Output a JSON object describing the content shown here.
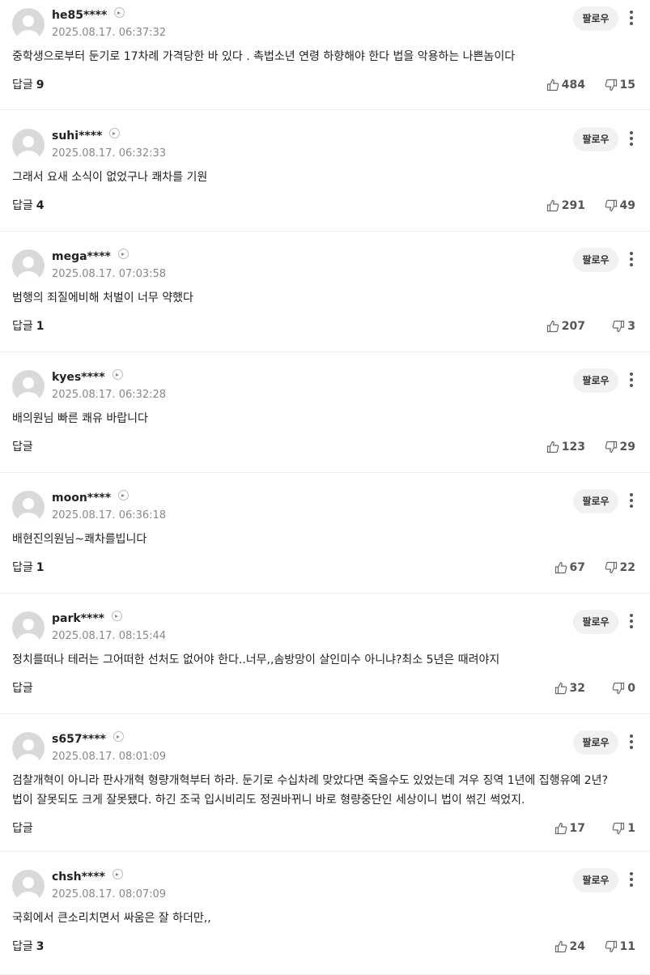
{
  "labels": {
    "follow": "팔로우",
    "reply": "답글"
  },
  "comments": [
    {
      "nickname": "he85****",
      "timestamp": "2025.08.17. 06:37:32",
      "text": "중학생으로부터 둔기로 17차례 가격당한 바 있다 . 촉법소년 연령 하향해야 한다 법을 악용하는 나쁜놈이다",
      "reply_count": "9",
      "likes": "484",
      "dislikes": "15"
    },
    {
      "nickname": "suhi****",
      "timestamp": "2025.08.17. 06:32:33",
      "text": "그래서 요새 소식이 없었구나 쾌차를 기원",
      "reply_count": "4",
      "likes": "291",
      "dislikes": "49"
    },
    {
      "nickname": "mega****",
      "timestamp": "2025.08.17. 07:03:58",
      "text": "범행의 죄질에비해 처벌이 너무 약했다",
      "reply_count": "1",
      "likes": "207",
      "dislikes": "3"
    },
    {
      "nickname": "kyes****",
      "timestamp": "2025.08.17. 06:32:28",
      "text": "배의원님 빠른 쾌유 바랍니다",
      "reply_count": "",
      "likes": "123",
      "dislikes": "29"
    },
    {
      "nickname": "moon****",
      "timestamp": "2025.08.17. 06:36:18",
      "text": "배현진의원님~쾌차를빕니다",
      "reply_count": "1",
      "likes": "67",
      "dislikes": "22"
    },
    {
      "nickname": "park****",
      "timestamp": "2025.08.17. 08:15:44",
      "text": "정치를떠나 테러는 그어떠한 선처도 없어야 한다..너무,,솜방망이 살인미수 아니냐?최소 5년은 때려야지",
      "reply_count": "",
      "likes": "32",
      "dislikes": "0"
    },
    {
      "nickname": "s657****",
      "timestamp": "2025.08.17. 08:01:09",
      "text": "검찰개혁이 아니라 판사개혁 형량개혁부터 하라. 둔기로 수십차례 맞았다면 죽을수도 있었는데 겨우 징역 1년에 집행유예 2년? 법이 잘못되도 크게 잘못됐다. 하긴 조국 입시비리도 정권바뀌니 바로 형량중단인 세상이니 법이 썪긴 썩었지.",
      "reply_count": "",
      "likes": "17",
      "dislikes": "1"
    },
    {
      "nickname": "chsh****",
      "timestamp": "2025.08.17. 08:07:09",
      "text": "국회에서 큰소리치면서 싸움은 잘 하더만,,",
      "reply_count": "3",
      "likes": "24",
      "dislikes": "11"
    }
  ]
}
